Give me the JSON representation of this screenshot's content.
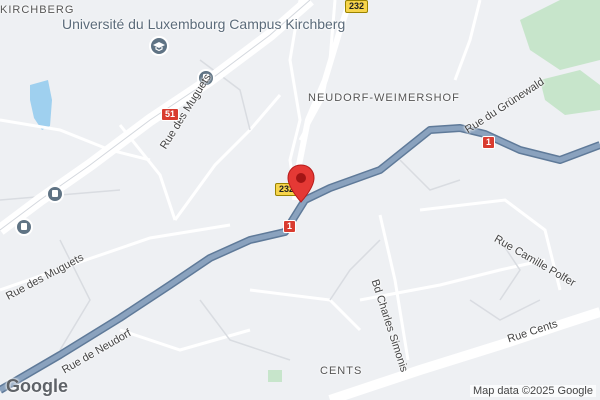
{
  "map": {
    "colors": {
      "background": "#eef0f3",
      "highway": "#7b93b0",
      "highway_casing": "#5f7a99",
      "road": "#ffffff",
      "minor_road": "#d9dce1",
      "water": "#9fd0ef",
      "park": "#c7e5cb",
      "marker": "#e53935",
      "route_shield_red": "#d93b2f",
      "route_shield_yellow": "#f6d44b"
    },
    "labels": {
      "area_kirchberg": "KIRCHBERG",
      "area_neudorf": "NEUDORF-WEIMERSHOF",
      "area_cents": "CENTS",
      "poi_university": "Université du Luxembourg Campus Kirchberg",
      "street_muguets_1": "Rue des Muguets",
      "street_muguets_2": "Rue des Muguets",
      "street_neudorf": "Rue de Neudorf",
      "street_grunewald": "Rue du Grünewald",
      "street_simonis": "Bd Charles Simonis",
      "street_polfer": "Rue Camille Polfer",
      "street_cents": "Rue Cents"
    },
    "shields": {
      "r232_top": "232",
      "r232_mid": "232",
      "r51": "51",
      "r1_left": "1",
      "r1_right": "1"
    },
    "icons": {
      "university": "graduation-cap-icon",
      "bus_stop": "bus-stop-icon",
      "marker": "location-pin-icon"
    }
  },
  "footer": {
    "logo": "Google",
    "attribution": "Map data ©2025 Google"
  }
}
